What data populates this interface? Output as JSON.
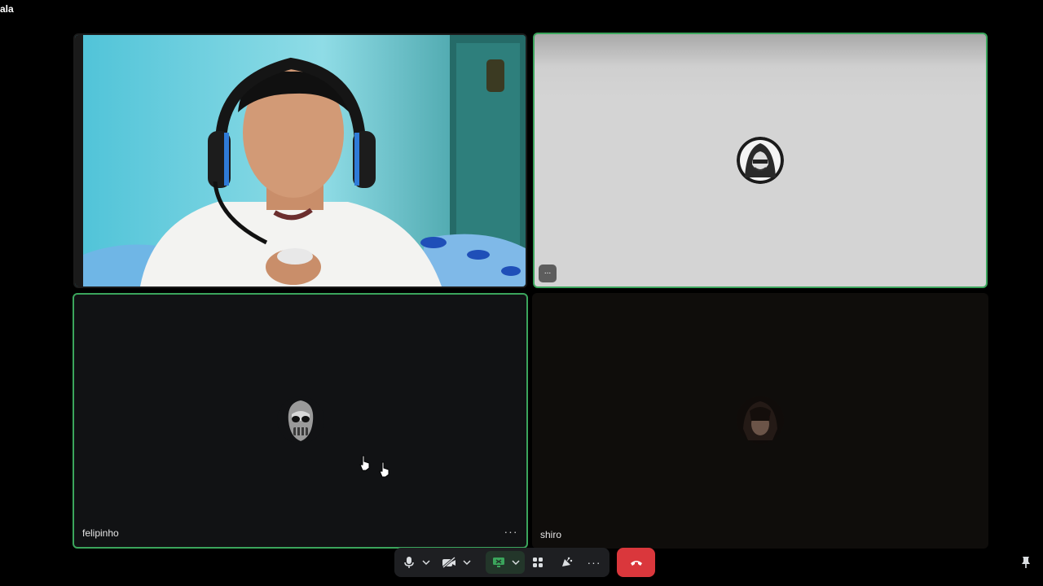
{
  "room": {
    "title": "ala"
  },
  "tiles": {
    "camera": {
      "label": ""
    },
    "light": {
      "chip_label": "..."
    },
    "felipinho": {
      "name": "felipinho",
      "more_label": "···"
    },
    "shiro": {
      "name": "shiro"
    }
  },
  "toolbar": {
    "mic_icon": "microphone-icon",
    "camera_icon": "camera-off-icon",
    "screen_icon": "screen-share-icon",
    "activities_icon": "activities-icon",
    "soundboard_icon": "soundboard-icon",
    "more_label": "···",
    "leave_icon": "hang-up-icon"
  },
  "colors": {
    "speaking_border": "#3ba55c",
    "leave_button": "#da373c",
    "toolbar_bg": "#1e1f22",
    "screen_share_active": "#3ba55c"
  }
}
